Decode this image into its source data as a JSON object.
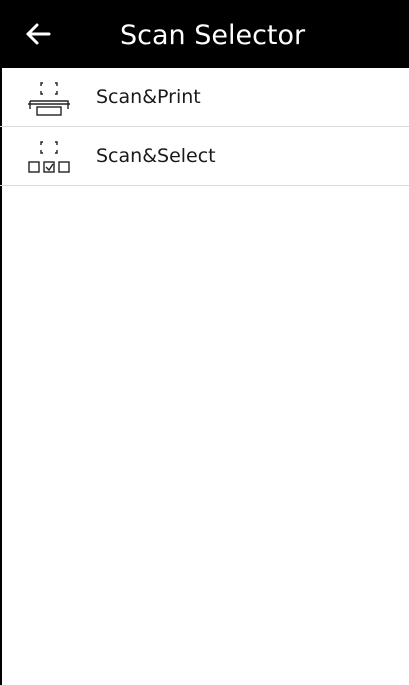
{
  "header": {
    "back_icon": "arrow-left-icon",
    "title": "Scan Selector"
  },
  "menu": {
    "items": [
      {
        "label": "Scan&Print",
        "icon": "scan-print-icon"
      },
      {
        "label": "Scan&Select",
        "icon": "scan-select-icon"
      }
    ]
  },
  "colors": {
    "header_bg": "#000000",
    "header_text": "#ffffff",
    "divider": "#d9d9d9"
  }
}
